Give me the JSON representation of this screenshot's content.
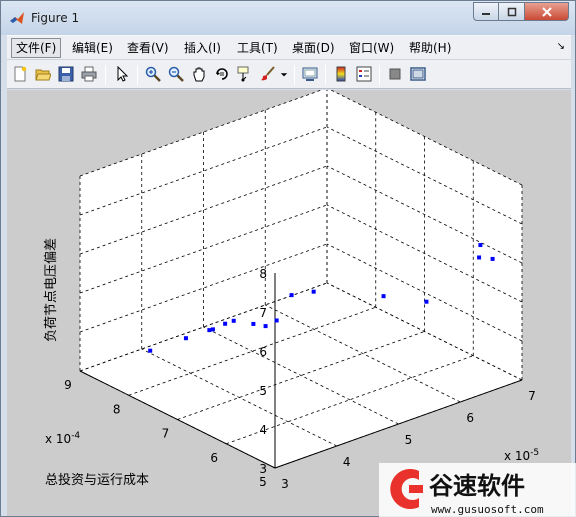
{
  "window": {
    "title": "Figure 1"
  },
  "menu": {
    "items": [
      "文件(F)",
      "编辑(E)",
      "查看(V)",
      "插入(I)",
      "工具(T)",
      "桌面(D)",
      "窗口(W)",
      "帮助(H)"
    ],
    "overflow_arrow": "↘"
  },
  "toolbar": {
    "icons": [
      "new-figure-icon",
      "open-file-icon",
      "save-figure-icon",
      "print-figure-icon",
      "edit-plot-icon",
      "zoom-in-icon",
      "zoom-out-icon",
      "pan-icon",
      "rotate-3d-icon",
      "data-cursor-icon",
      "brush-icon",
      "link-plot-icon",
      "colorbar-icon",
      "legend-icon",
      "hide-plot-tools-icon",
      "show-plot-tools-icon"
    ]
  },
  "chart_data": {
    "type": "scatter",
    "projection": "3d",
    "title": "",
    "xlabel": "",
    "ylabel": "总投资与运行成本",
    "zlabel": "负荷节点电压偏差",
    "x_exponent_label": "x 10",
    "x_exponent": "-5",
    "y_exponent_label": "x 10",
    "y_exponent": "-4",
    "xlim": [
      3,
      7
    ],
    "ylim": [
      5,
      9
    ],
    "zlim": [
      3,
      8
    ],
    "x_ticks": [
      "3",
      "4",
      "5",
      "6",
      "7"
    ],
    "y_ticks": [
      "5",
      "6",
      "7",
      "8",
      "9"
    ],
    "z_ticks": [
      "3",
      "4",
      "5",
      "6",
      "7",
      "8"
    ],
    "grid": true,
    "marker_color": "#0000ff",
    "points": [
      {
        "x": 3.9,
        "y": 8.7,
        "z": 3.2
      },
      {
        "x": 4.4,
        "y": 8.6,
        "z": 3.3
      },
      {
        "x": 4.7,
        "y": 8.5,
        "z": 3.4
      },
      {
        "x": 4.6,
        "y": 8.3,
        "z": 3.6
      },
      {
        "x": 4.6,
        "y": 8.05,
        "z": 3.9
      },
      {
        "x": 4.7,
        "y": 8.0,
        "z": 3.95
      },
      {
        "x": 4.9,
        "y": 7.85,
        "z": 3.85
      },
      {
        "x": 4.9,
        "y": 7.6,
        "z": 3.95
      },
      {
        "x": 5.0,
        "y": 7.5,
        "z": 4.1
      },
      {
        "x": 5.4,
        "y": 7.7,
        "z": 4.4
      },
      {
        "x": 5.6,
        "y": 7.5,
        "z": 4.5
      },
      {
        "x": 6.1,
        "y": 6.7,
        "z": 4.6
      },
      {
        "x": 6.4,
        "y": 6.2,
        "z": 4.6
      },
      {
        "x": 6.7,
        "y": 5.5,
        "z": 6.0
      },
      {
        "x": 6.8,
        "y": 5.35,
        "z": 6.0
      },
      {
        "x": 6.8,
        "y": 5.6,
        "z": 6.2
      }
    ]
  },
  "watermark": {
    "brand_name": "谷速软件",
    "url": "www.gusuosoft.com",
    "accent": "#e8322b"
  }
}
